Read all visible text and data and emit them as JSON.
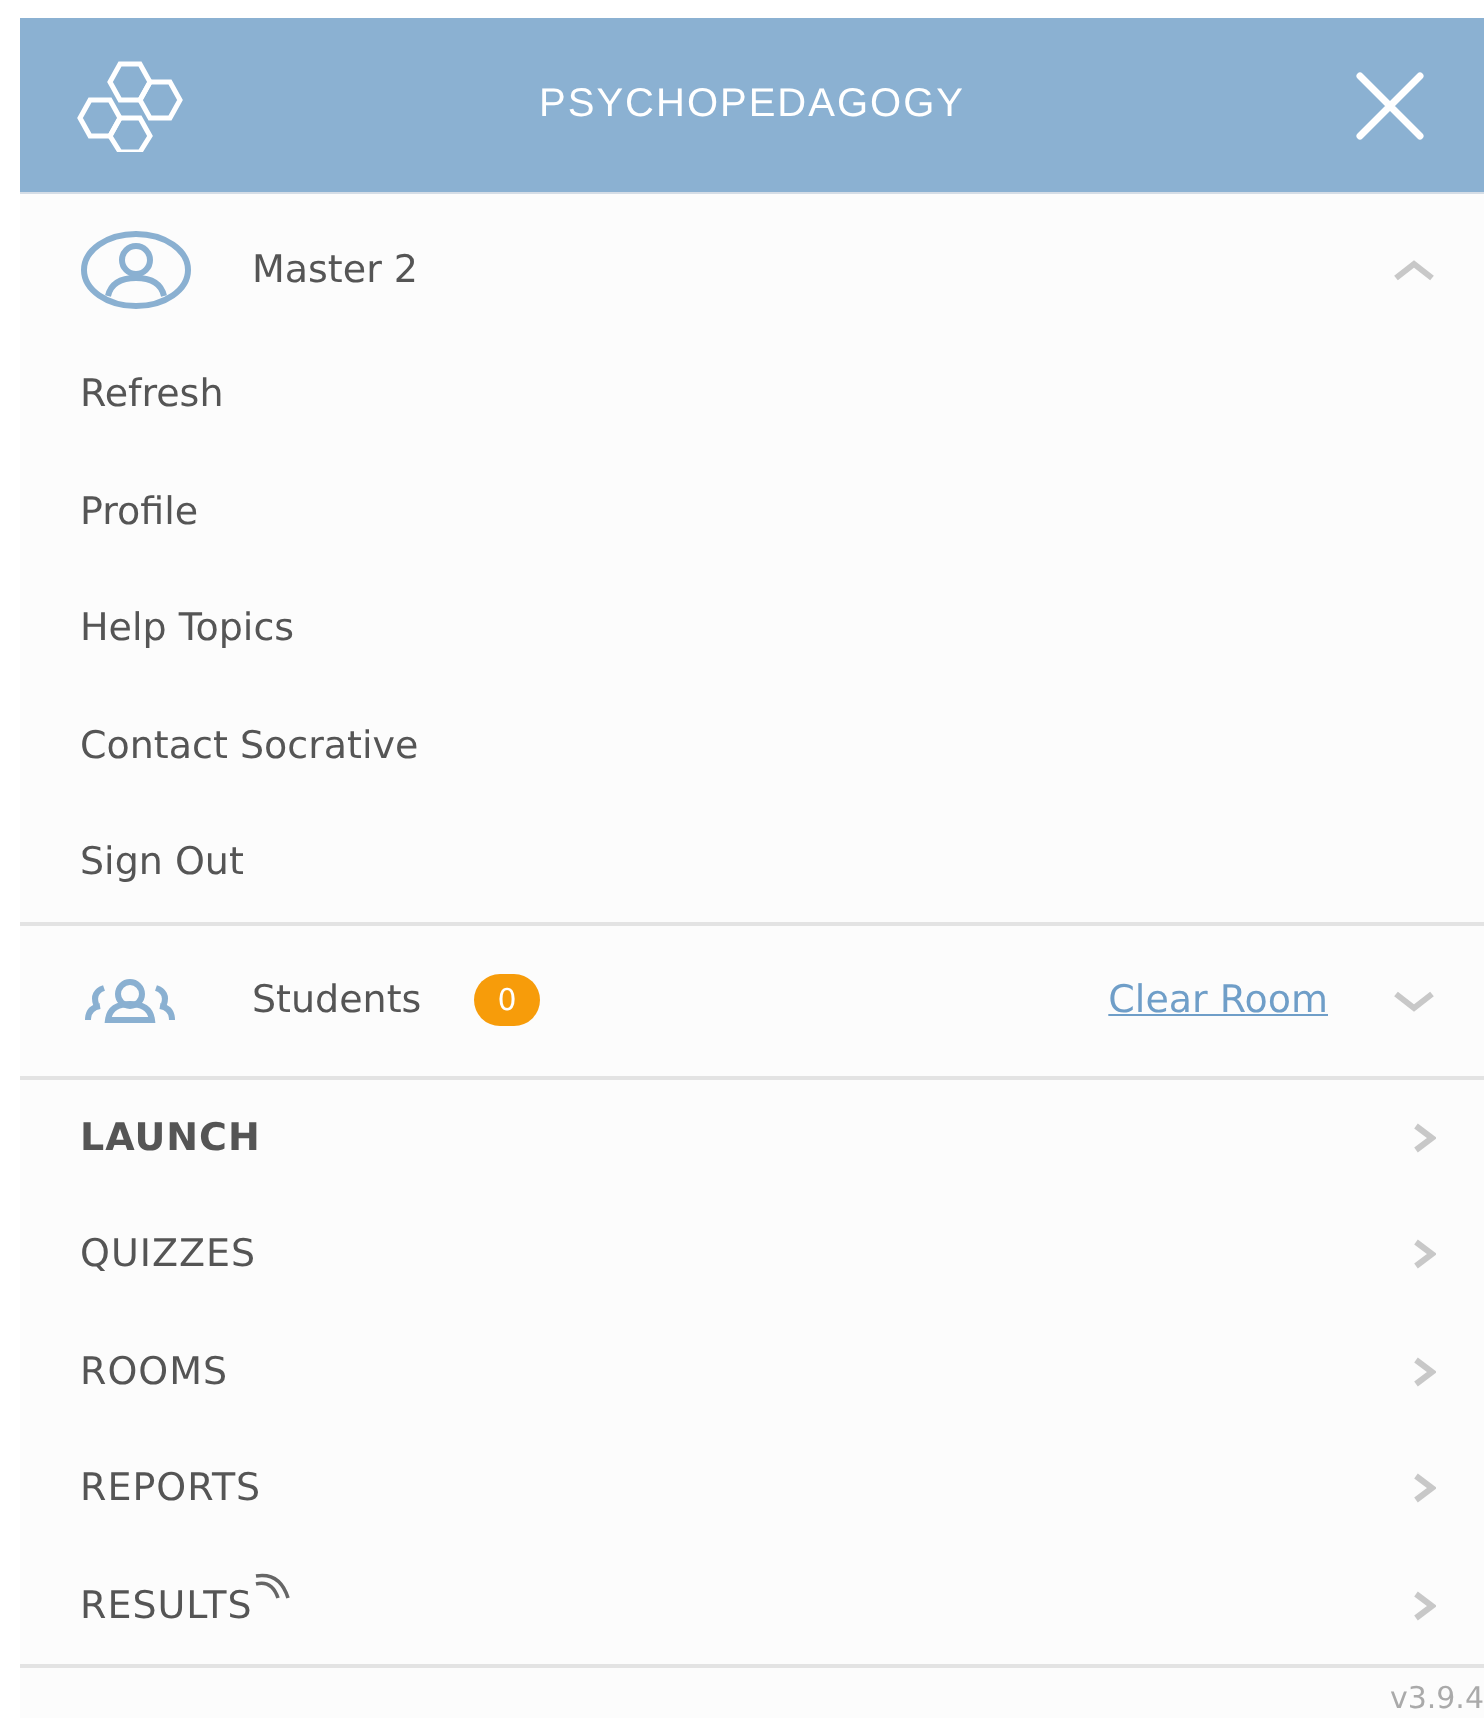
{
  "header": {
    "title": "PSYCHOPEDAGOGY"
  },
  "account": {
    "name": "Master 2",
    "expanded": true,
    "items": [
      "Refresh",
      "Profile",
      "Help Topics",
      "Contact Socrative",
      "Sign Out"
    ]
  },
  "students": {
    "label": "Students",
    "count": "0",
    "action": "Clear Room",
    "expanded": false
  },
  "nav": [
    {
      "label": "LAUNCH",
      "selected": true,
      "live": false
    },
    {
      "label": "QUIZZES",
      "selected": false,
      "live": false
    },
    {
      "label": "ROOMS",
      "selected": false,
      "live": false
    },
    {
      "label": "REPORTS",
      "selected": false,
      "live": false
    },
    {
      "label": "RESULTS",
      "selected": false,
      "live": true
    }
  ],
  "version": "v3.9.4"
}
